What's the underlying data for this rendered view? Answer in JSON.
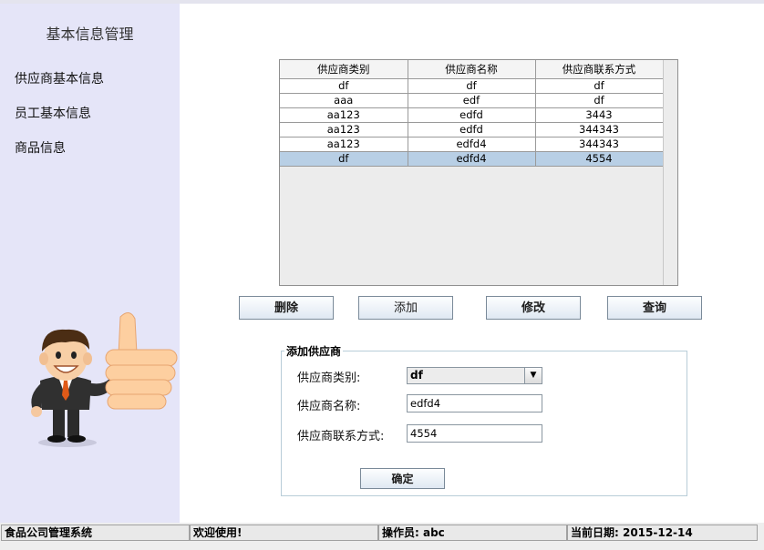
{
  "sidebar": {
    "title": "基本信息管理",
    "items": [
      {
        "label": "供应商基本信息"
      },
      {
        "label": "员工基本信息"
      },
      {
        "label": "商品信息"
      }
    ]
  },
  "table": {
    "columns": [
      "供应商类别",
      "供应商名称",
      "供应商联系方式"
    ],
    "rows": [
      [
        "df",
        "df",
        "df"
      ],
      [
        "aaa",
        "edf",
        "df"
      ],
      [
        "aa123",
        "edfd",
        "3443"
      ],
      [
        "aa123",
        "edfd",
        "344343"
      ],
      [
        "aa123",
        "edfd4",
        "344343"
      ],
      [
        "df",
        "edfd4",
        "4554"
      ]
    ],
    "selected_row": 5
  },
  "buttons": {
    "delete": "删除",
    "add": "添加",
    "modify": "修改",
    "query": "查询"
  },
  "form": {
    "legend": "添加供应商",
    "category_label": "供应商类别:",
    "category_value": "df",
    "name_label": "供应商名称:",
    "name_value": "edfd4",
    "contact_label": "供应商联系方式:",
    "contact_value": "4554",
    "confirm": "确定"
  },
  "statusbar": {
    "system": "食品公司管理系统",
    "welcome": "欢迎使用!",
    "operator": "操作员: abc",
    "date": "当前日期: 2015-12-14"
  },
  "icons": {
    "mascot": "thumbs-up-businessman",
    "combo_arrow": "chevron-down-icon"
  },
  "colors": {
    "sidebar_bg": "#e5e5f8",
    "selected_row": "#b8cfe5"
  }
}
